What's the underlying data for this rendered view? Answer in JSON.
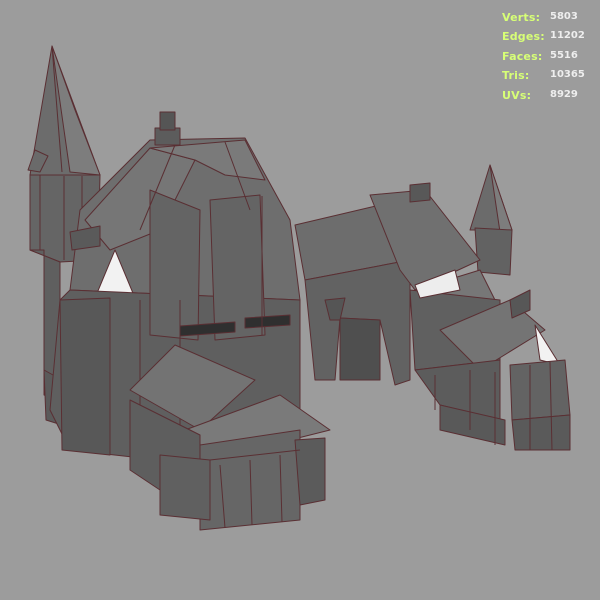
{
  "viewport": {
    "background": "#9c9c9c",
    "wire_color": "#5a2f33",
    "shading_color": "#6e6e6e"
  },
  "hud": {
    "label_color": "#d7ff76",
    "value_color": "#eeeeee",
    "stats": [
      {
        "label": "Verts:",
        "value": "5803"
      },
      {
        "label": "Edges:",
        "value": "11202"
      },
      {
        "label": "Faces:",
        "value": "5516"
      },
      {
        "label": "Tris:",
        "value": "10365"
      },
      {
        "label": "UVs:",
        "value": "8929"
      }
    ]
  }
}
